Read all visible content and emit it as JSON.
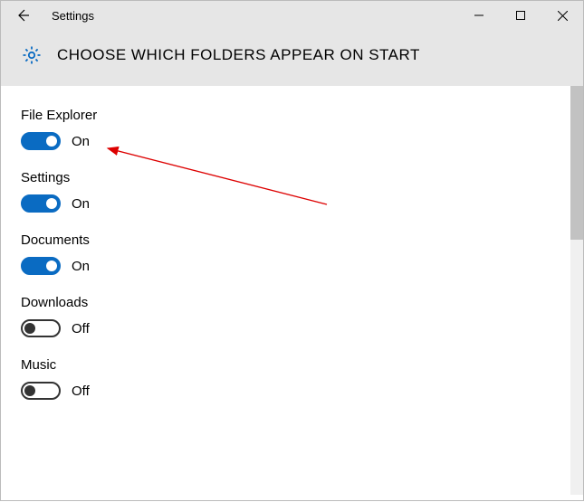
{
  "titlebar": {
    "title": "Settings"
  },
  "header": {
    "title": "CHOOSE WHICH FOLDERS APPEAR ON START"
  },
  "labels": {
    "on": "On",
    "off": "Off"
  },
  "settings": [
    {
      "name": "File Explorer",
      "on": true
    },
    {
      "name": "Settings",
      "on": true
    },
    {
      "name": "Documents",
      "on": true
    },
    {
      "name": "Downloads",
      "on": false
    },
    {
      "name": "Music",
      "on": false
    }
  ],
  "colors": {
    "accent": "#0a6bc2",
    "headerBg": "#e6e6e6"
  }
}
